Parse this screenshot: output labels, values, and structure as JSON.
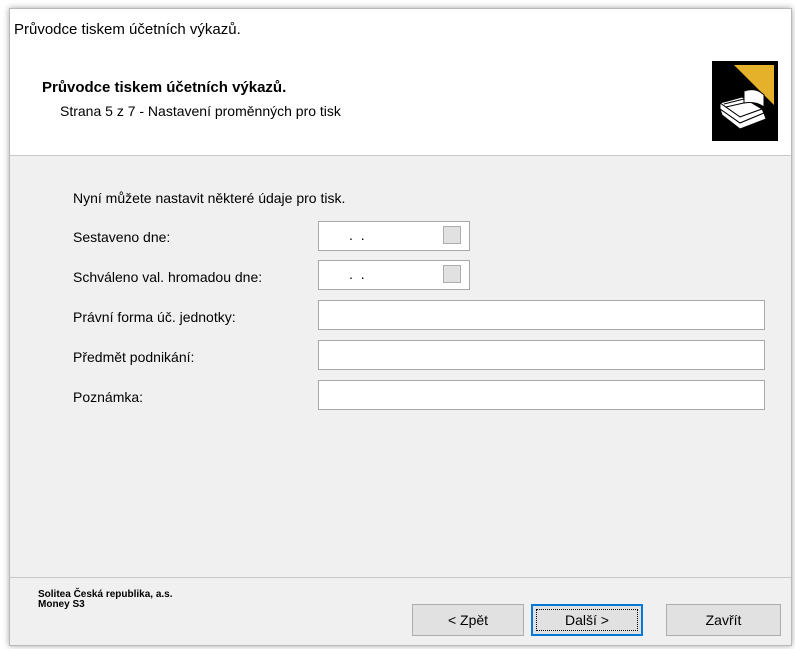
{
  "window": {
    "title": "Průvodce tiskem účetních výkazů."
  },
  "header": {
    "title": "Průvodce tiskem účetních výkazů.",
    "subtitle": "Strana 5 z 7 - Nastavení proměnných pro tisk"
  },
  "form": {
    "intro": "Nyní můžete nastavit některé údaje pro tisk.",
    "fields": [
      {
        "label": "Sestaveno dne:",
        "value": ".  .",
        "type": "date"
      },
      {
        "label": "Schváleno val. hromadou dne:",
        "value": ".  .",
        "type": "date"
      },
      {
        "label": "Právní forma úč. jednotky:",
        "value": "",
        "type": "text"
      },
      {
        "label": "Předmět podnikání:",
        "value": "",
        "type": "text"
      },
      {
        "label": "Poznámka:",
        "value": "",
        "type": "text"
      }
    ]
  },
  "footer": {
    "company_line1": "Solitea Česká republika, a.s.",
    "company_line2": "Money S3",
    "back_label": "< Zpět",
    "next_label": "Další >",
    "close_label": "Zavřít"
  }
}
